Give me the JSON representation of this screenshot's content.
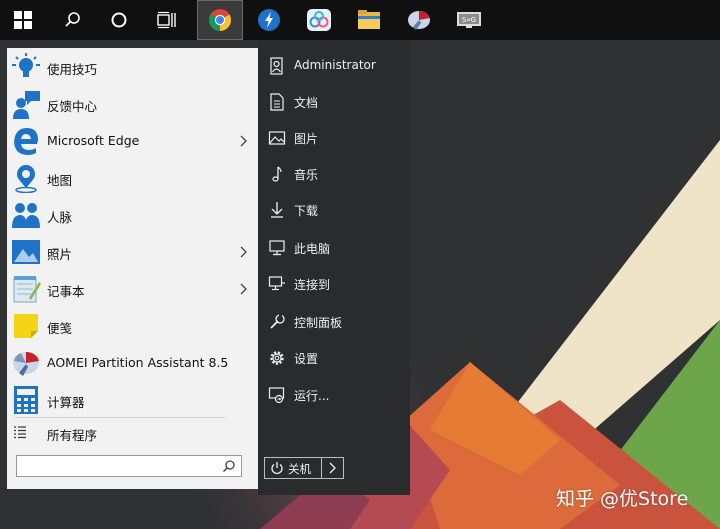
{
  "taskbar": {
    "icons": [
      {
        "name": "windows-start-icon"
      },
      {
        "name": "search-icon"
      },
      {
        "name": "cortana-icon"
      },
      {
        "name": "task-view-icon"
      },
      {
        "name": "chrome-icon"
      },
      {
        "name": "blue-app-icon"
      },
      {
        "name": "baidu-netdisk-icon"
      },
      {
        "name": "file-explorer-icon"
      },
      {
        "name": "aomei-partition-icon"
      },
      {
        "name": "s2g-app-icon"
      }
    ],
    "active_index": 4
  },
  "start_menu": {
    "programs": [
      {
        "label": "使用技巧",
        "icon": "tips-bulb-icon",
        "has_submenu": false
      },
      {
        "label": "反馈中心",
        "icon": "feedback-hub-icon",
        "has_submenu": false
      },
      {
        "label": "Microsoft Edge",
        "icon": "edge-icon",
        "has_submenu": true
      },
      {
        "label": "地图",
        "icon": "maps-icon",
        "has_submenu": false
      },
      {
        "label": "人脉",
        "icon": "people-icon",
        "has_submenu": false
      },
      {
        "label": "照片",
        "icon": "photos-icon",
        "has_submenu": true
      },
      {
        "label": "记事本",
        "icon": "notepad-icon",
        "has_submenu": true
      },
      {
        "label": "便笺",
        "icon": "sticky-notes-icon",
        "has_submenu": false
      },
      {
        "label": "AOMEI Partition Assistant 8.5",
        "icon": "aomei-icon",
        "has_submenu": false
      },
      {
        "label": "计算器",
        "icon": "calculator-icon",
        "has_submenu": false
      }
    ],
    "all_programs": "所有程序",
    "search": {
      "value": "",
      "placeholder": ""
    },
    "right_items": [
      {
        "label": "Administrator",
        "icon": "user-icon"
      },
      {
        "label": "文档",
        "icon": "documents-icon"
      },
      {
        "label": "图片",
        "icon": "pictures-icon"
      },
      {
        "label": "音乐",
        "icon": "music-icon"
      },
      {
        "label": "下载",
        "icon": "downloads-icon"
      },
      {
        "label": "此电脑",
        "icon": "this-pc-icon"
      },
      {
        "label": "连接到",
        "icon": "connect-to-icon"
      },
      {
        "label": "控制面板",
        "icon": "control-panel-icon"
      },
      {
        "label": "设置",
        "icon": "settings-gear-icon"
      },
      {
        "label": "运行...",
        "icon": "run-icon"
      }
    ],
    "power_label": "关机"
  },
  "watermark": "知乎 @优Store",
  "colors": {
    "taskbar": "#101010",
    "menu_left": "#f2f2f2",
    "menu_right": "#2a2b2c",
    "desktop": "#2f3133",
    "accent_blue": "#1e73c8"
  }
}
